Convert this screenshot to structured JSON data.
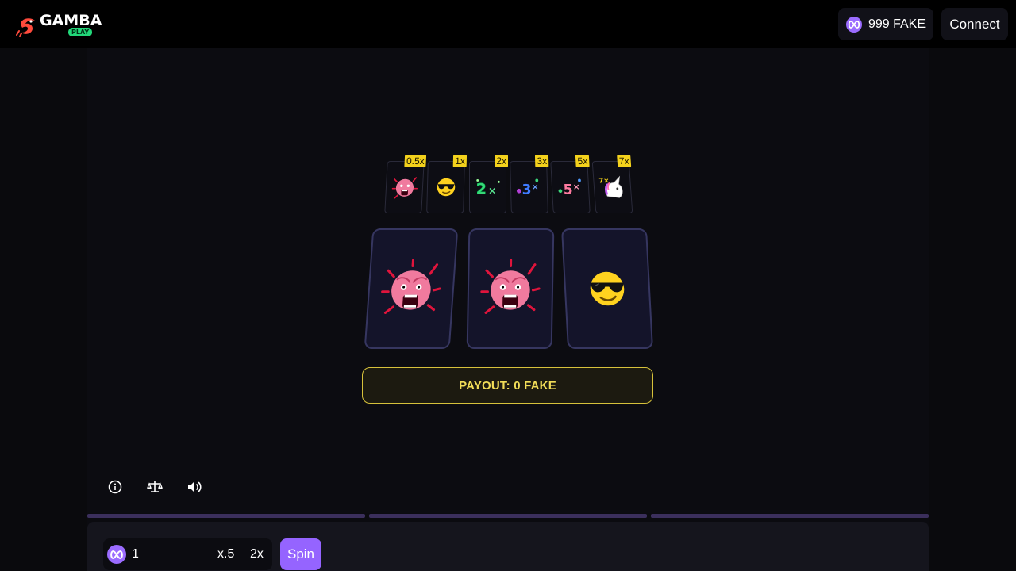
{
  "header": {
    "logo_text": "GAMBA",
    "logo_badge": "PLAY",
    "balance": "999 FAKE",
    "connect_label": "Connect"
  },
  "paytable": [
    {
      "multiplier": "0.5x",
      "icon": "rage-face-icon"
    },
    {
      "multiplier": "1x",
      "icon": "sunglasses-face-icon"
    },
    {
      "multiplier": "2x",
      "icon": "2x-icon"
    },
    {
      "multiplier": "3x",
      "icon": "3x-icon"
    },
    {
      "multiplier": "5x",
      "icon": "5x-icon"
    },
    {
      "multiplier": "7x",
      "icon": "unicorn-icon"
    }
  ],
  "reels": [
    {
      "icon": "rage-face-icon"
    },
    {
      "icon": "rage-face-icon"
    },
    {
      "icon": "sunglasses-face-icon"
    }
  ],
  "payout_text": "PAYOUT: 0 FAKE",
  "tools": [
    "info-icon",
    "fairness-scale-icon",
    "volume-icon"
  ],
  "controls": {
    "wager_value": "1",
    "half_label": "x.5",
    "double_label": "2x",
    "spin_label": "Spin"
  },
  "colors": {
    "accent": "#9564ff",
    "payout": "#f1dd58",
    "badge": "#f4d21c"
  }
}
